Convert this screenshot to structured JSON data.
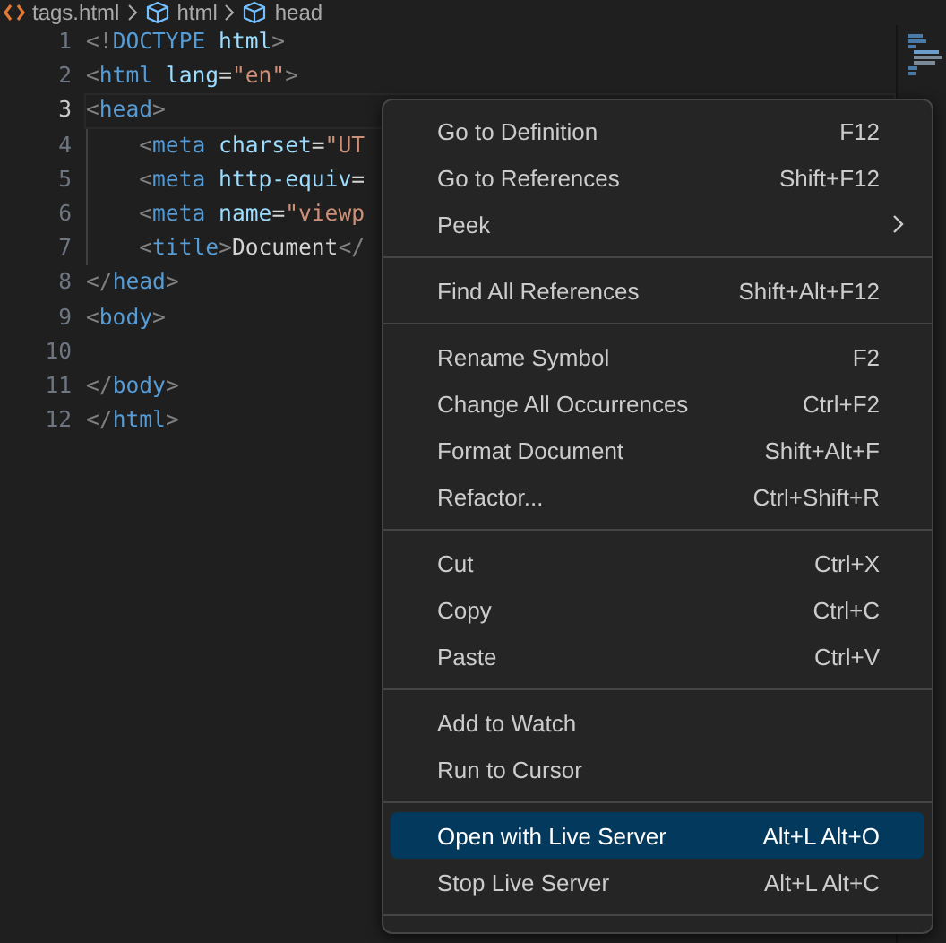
{
  "breadcrumb": [
    {
      "label": "tags.html",
      "kind": "file"
    },
    {
      "label": "html",
      "kind": "element"
    },
    {
      "label": "head",
      "kind": "element"
    }
  ],
  "editor": {
    "lines": [
      {
        "number": "1",
        "current": false,
        "tokens": [
          {
            "kind": "punct",
            "text": "<!"
          },
          {
            "kind": "tag",
            "text": "DOCTYPE"
          },
          {
            "kind": "attr",
            "text": " html"
          },
          {
            "kind": "punct",
            "text": ">"
          }
        ]
      },
      {
        "number": "2",
        "current": false,
        "tokens": [
          {
            "kind": "punct",
            "text": "<"
          },
          {
            "kind": "tag",
            "text": "html"
          },
          {
            "kind": "attr",
            "text": " lang"
          },
          {
            "kind": "plain",
            "text": "="
          },
          {
            "kind": "str",
            "text": "\"en\""
          },
          {
            "kind": "punct",
            "text": ">"
          }
        ]
      },
      {
        "number": "3",
        "current": true,
        "tokens": [
          {
            "kind": "punct",
            "text": "<"
          },
          {
            "kind": "tag",
            "text": "head"
          },
          {
            "kind": "punct",
            "text": ">"
          }
        ]
      },
      {
        "number": "4",
        "current": false,
        "tokens": [
          {
            "kind": "punct",
            "text": "    <"
          },
          {
            "kind": "tag",
            "text": "meta"
          },
          {
            "kind": "attr",
            "text": " charset"
          },
          {
            "kind": "plain",
            "text": "="
          },
          {
            "kind": "str",
            "text": "\"UT"
          }
        ]
      },
      {
        "number": "5",
        "current": false,
        "tokens": [
          {
            "kind": "punct",
            "text": "    <"
          },
          {
            "kind": "tag",
            "text": "meta"
          },
          {
            "kind": "attr",
            "text": " http-equiv"
          },
          {
            "kind": "plain",
            "text": "="
          }
        ]
      },
      {
        "number": "6",
        "current": false,
        "tokens": [
          {
            "kind": "punct",
            "text": "    <"
          },
          {
            "kind": "tag",
            "text": "meta"
          },
          {
            "kind": "attr",
            "text": " name"
          },
          {
            "kind": "plain",
            "text": "="
          },
          {
            "kind": "str",
            "text": "\"viewp"
          }
        ]
      },
      {
        "number": "7",
        "current": false,
        "tokens": [
          {
            "kind": "punct",
            "text": "    <"
          },
          {
            "kind": "tag",
            "text": "title"
          },
          {
            "kind": "punct",
            "text": ">"
          },
          {
            "kind": "plain",
            "text": "Document"
          },
          {
            "kind": "punct",
            "text": "</"
          }
        ]
      },
      {
        "number": "8",
        "current": false,
        "tokens": [
          {
            "kind": "punct",
            "text": "</"
          },
          {
            "kind": "tag",
            "text": "head"
          },
          {
            "kind": "punct",
            "text": ">"
          }
        ]
      },
      {
        "number": "9",
        "current": false,
        "tokens": [
          {
            "kind": "punct",
            "text": "<"
          },
          {
            "kind": "tag",
            "text": "body"
          },
          {
            "kind": "punct",
            "text": ">"
          }
        ]
      },
      {
        "number": "10",
        "current": false
      },
      {
        "number": "11",
        "current": false,
        "tokens": [
          {
            "kind": "punct",
            "text": "</"
          },
          {
            "kind": "tag",
            "text": "body"
          },
          {
            "kind": "punct",
            "text": ">"
          }
        ]
      },
      {
        "number": "12",
        "current": false,
        "tokens": [
          {
            "kind": "punct",
            "text": "</"
          },
          {
            "kind": "tag",
            "text": "html"
          },
          {
            "kind": "punct",
            "text": ">"
          }
        ]
      }
    ]
  },
  "context_menu": {
    "groups": [
      [
        {
          "label": "Go to Definition",
          "shortcut": "F12",
          "submenu": false,
          "selected": false
        },
        {
          "label": "Go to References",
          "shortcut": "Shift+F12",
          "submenu": false,
          "selected": false
        },
        {
          "label": "Peek",
          "submenu": true,
          "selected": false
        }
      ],
      [
        {
          "label": "Find All References",
          "shortcut": "Shift+Alt+F12",
          "submenu": false,
          "selected": false
        }
      ],
      [
        {
          "label": "Rename Symbol",
          "shortcut": "F2",
          "submenu": false,
          "selected": false
        },
        {
          "label": "Change All Occurrences",
          "shortcut": "Ctrl+F2",
          "submenu": false,
          "selected": false
        },
        {
          "label": "Format Document",
          "shortcut": "Shift+Alt+F",
          "submenu": false,
          "selected": false
        },
        {
          "label": "Refactor...",
          "shortcut": "Ctrl+Shift+R",
          "submenu": false,
          "selected": false
        }
      ],
      [
        {
          "label": "Cut",
          "shortcut": "Ctrl+X",
          "submenu": false,
          "selected": false
        },
        {
          "label": "Copy",
          "shortcut": "Ctrl+C",
          "submenu": false,
          "selected": false
        },
        {
          "label": "Paste",
          "shortcut": "Ctrl+V",
          "submenu": false,
          "selected": false
        }
      ],
      [
        {
          "label": "Add to Watch",
          "submenu": false,
          "selected": false
        },
        {
          "label": "Run to Cursor",
          "submenu": false,
          "selected": false
        }
      ],
      [
        {
          "label": "Open with Live Server",
          "shortcut": "Alt+L Alt+O",
          "submenu": false,
          "selected": true
        },
        {
          "label": "Stop Live Server",
          "shortcut": "Alt+L Alt+C",
          "submenu": false,
          "selected": false
        }
      ]
    ]
  }
}
